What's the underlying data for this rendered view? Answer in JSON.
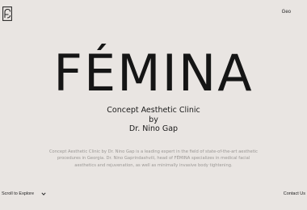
{
  "header": {
    "logo_icon": "femina-monogram-icon",
    "language_label": "Geo"
  },
  "hero": {
    "brand_name": "FÉMINA",
    "tagline_lines": [
      "Concept Aesthetic Clinic",
      "by",
      "Dr. Nino Gap"
    ],
    "description_lines": [
      "Concept Aesthetic Clinic by Dr. Nino Gap is a leading expert in the field of state-of-the-art aesthetic",
      "procedures in Georgia. Dr. Nino Gaprindashvili, head of FÉMINA specializes in medical facial",
      "aesthetics and rejuvenation, as well as minimally invasive body tightening."
    ]
  },
  "footer": {
    "scroll_label": "Scroll to Explore",
    "scroll_icon": "chevron-down-icon",
    "contact_label": "Contact Us"
  },
  "colors": {
    "background": "#e9e5e2",
    "text": "#1d1d1d",
    "muted": "#9a9794"
  }
}
